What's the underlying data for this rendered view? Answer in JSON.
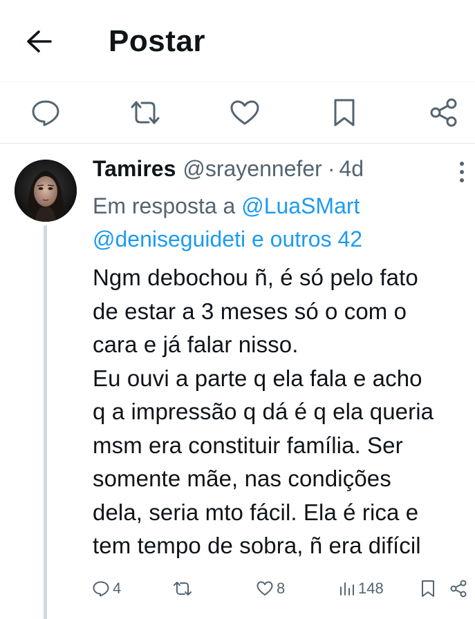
{
  "header": {
    "title": "Postar",
    "back_icon": "arrow-left-icon"
  },
  "actions": {
    "reply_icon": "comment-icon",
    "retweet_icon": "retweet-icon",
    "like_icon": "heart-icon",
    "bookmark_icon": "bookmark-icon",
    "share_icon": "share-icon"
  },
  "reply": {
    "author_name": "Tamires",
    "handle": "@srayennefer",
    "separator": "·",
    "time": "4d",
    "reply_prefix": "Em resposta a ",
    "mention_1": "@LuaSMart",
    "mention_2": "@deniseguideti e outros 42",
    "text": "Ngm debochou ñ, é só pelo fato\nde estar a 3 meses só o com o\ncara e já falar nisso.\nEu ouvi a parte q ela fala e acho\nq a impressão q dá é q ela queria\nmsm era constituir família. Ser\nsomente mãe, nas condições\ndela, seria mto fácil. Ela é rica e\ntem tempo de sobra, ñ era difícil",
    "stats": {
      "replies": "4",
      "retweets": "",
      "likes": "8",
      "views": "148"
    }
  },
  "colors": {
    "text_primary": "#0f1419",
    "text_secondary": "#536471",
    "link": "#1d9bf0",
    "divider": "#eff3f4",
    "thread_line": "#cfd9de"
  }
}
